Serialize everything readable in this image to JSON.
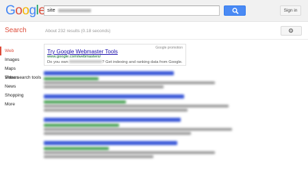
{
  "header": {
    "logo": "Google",
    "logo_colors": [
      "#4285f4",
      "#dd4b39",
      "#f4b400",
      "#4285f4",
      "#0f9d58",
      "#dd4b39"
    ],
    "search_value": "site",
    "search_button_icon": "magnifier-icon",
    "signin_label": "Sign in"
  },
  "subbar": {
    "heading": "Search",
    "results_stats": "About 232 results (0.18 seconds)",
    "settings_icon": "gear-icon"
  },
  "nav": {
    "items": [
      {
        "label": "Web",
        "active": true
      },
      {
        "label": "Images",
        "active": false
      },
      {
        "label": "Maps",
        "active": false
      },
      {
        "label": "Videos",
        "active": false
      },
      {
        "label": "News",
        "active": false
      },
      {
        "label": "Shopping",
        "active": false
      },
      {
        "label": "More",
        "active": false
      }
    ],
    "search_tools": "Show search tools"
  },
  "promo": {
    "label": "Google promotion",
    "title": "Try Google Webmaster Tools",
    "url": "www.google.com/webmasters/",
    "desc_before": "Do you own",
    "desc_after": "? Get indexing and ranking data from Google."
  },
  "colors": {
    "accent_red": "#dd4b39",
    "link_blue": "#1a0dab",
    "url_green": "#006621",
    "button_blue": "#4a8af4"
  }
}
